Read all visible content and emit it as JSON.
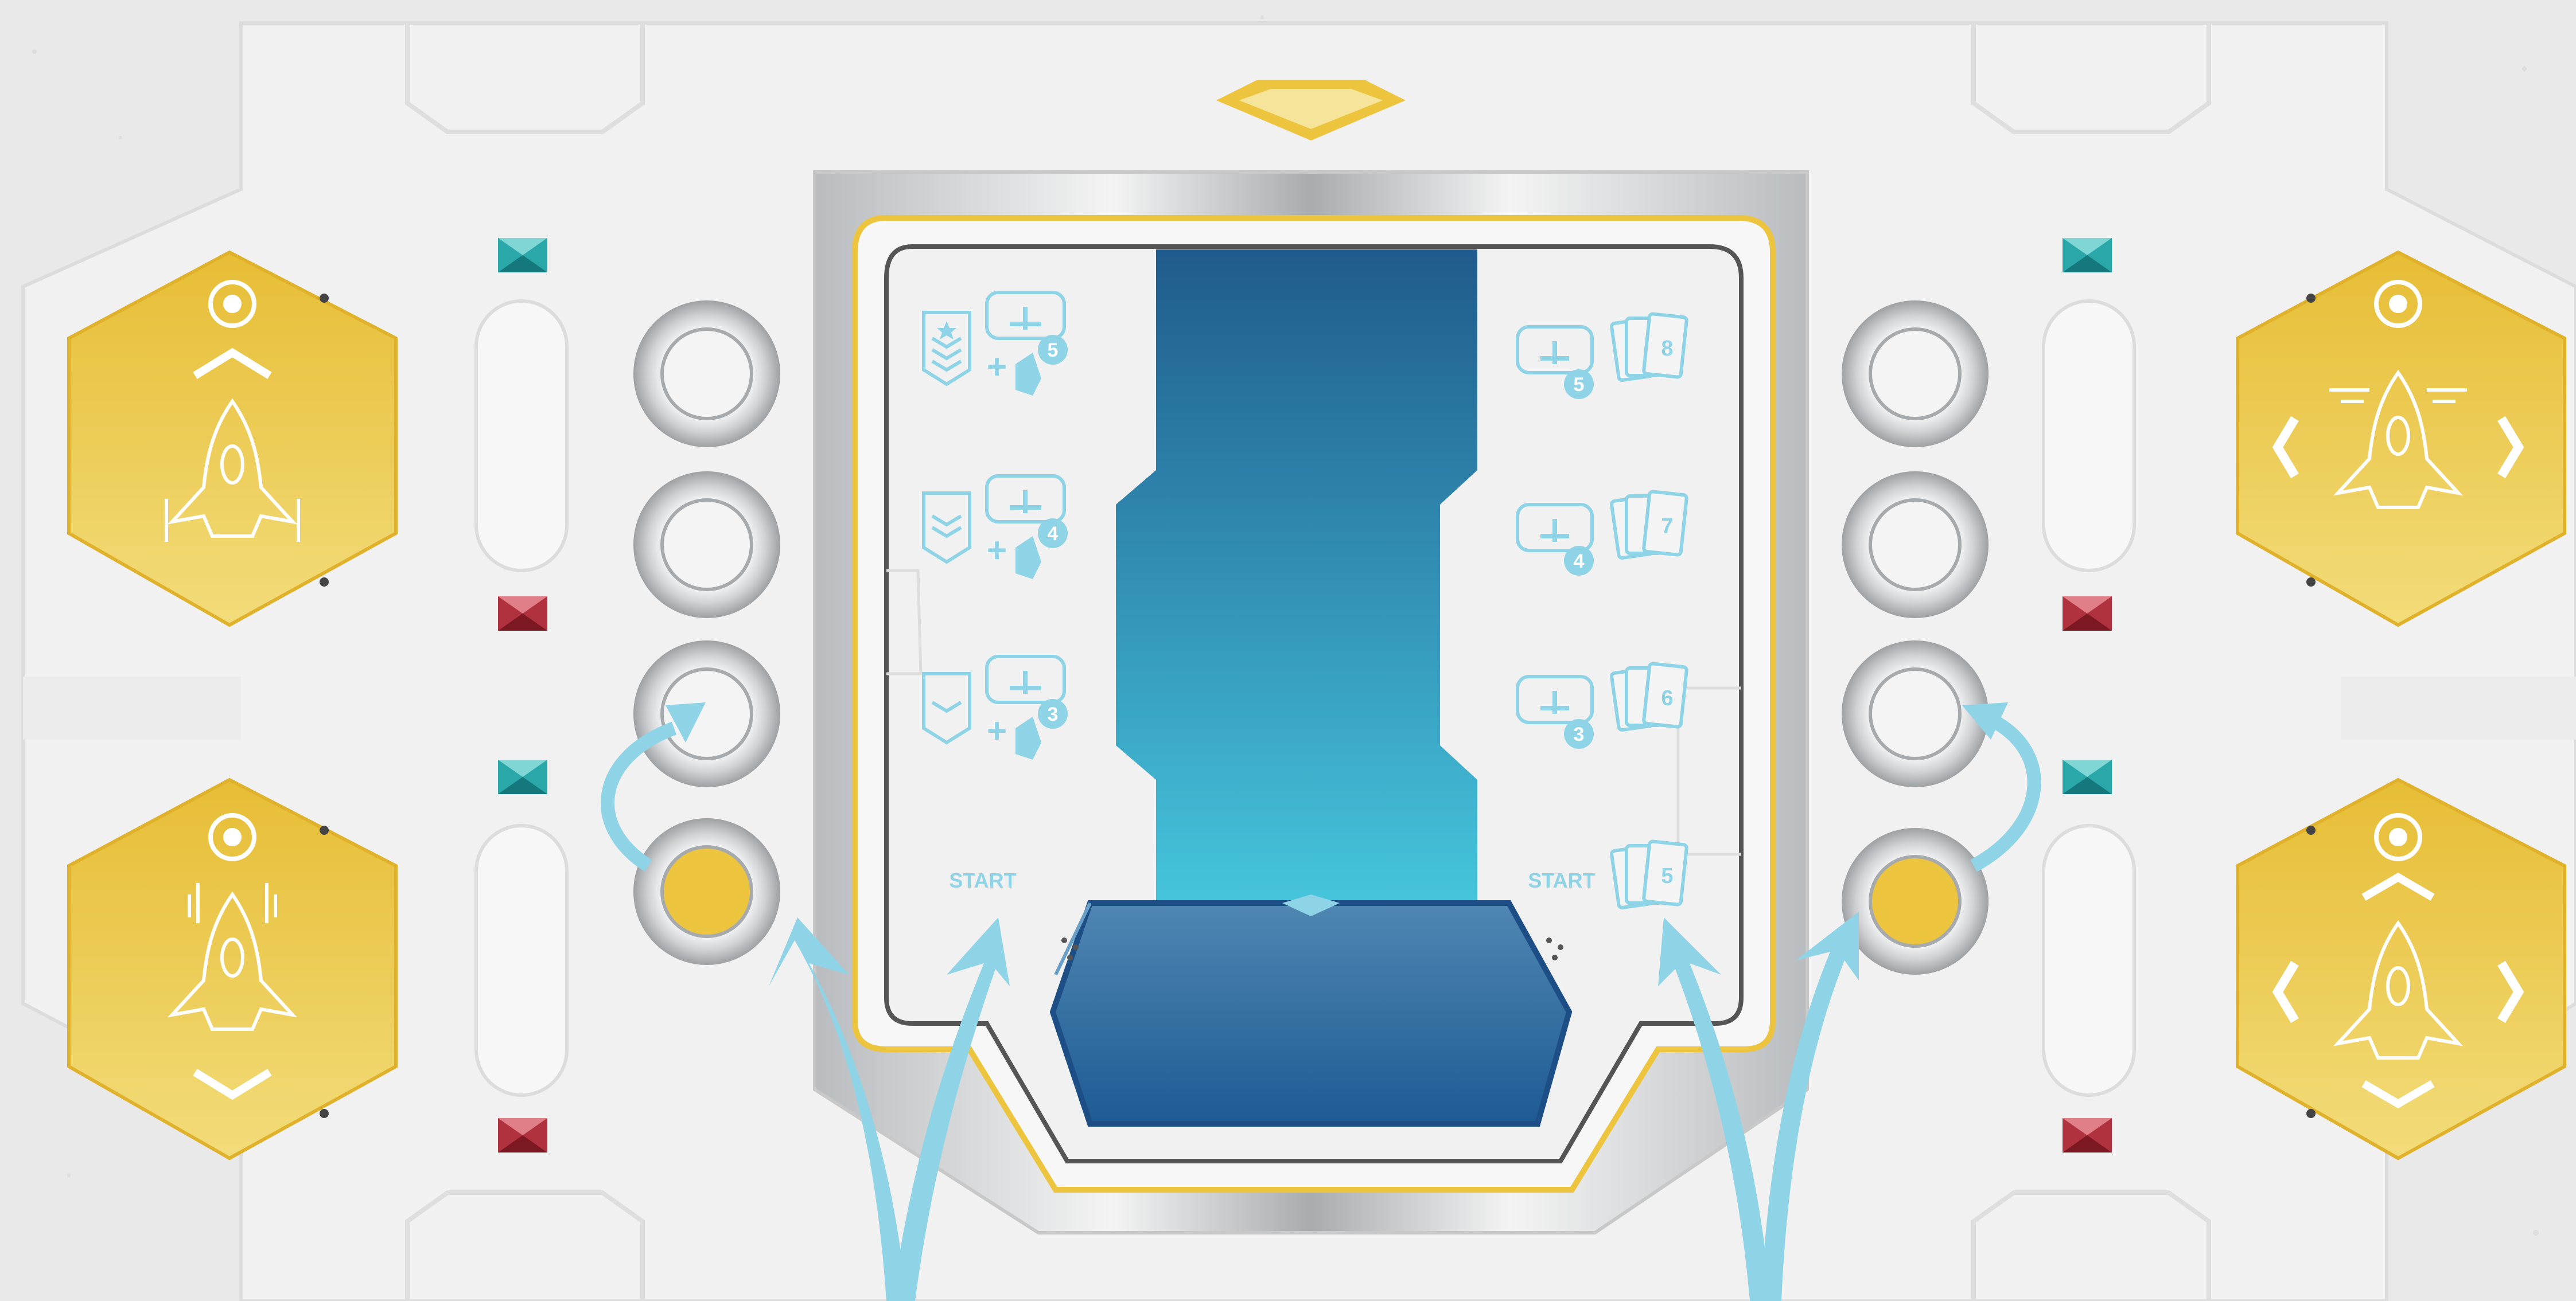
{
  "left_panel": {
    "ranks": [
      {
        "rank": "rank-3-chevrons-star",
        "fighters": "5"
      },
      {
        "rank": "rank-2-chevrons",
        "fighters": "4"
      },
      {
        "rank": "rank-1-chevron",
        "fighters": "3"
      }
    ],
    "start_label": "START"
  },
  "right_panel": {
    "rows": [
      {
        "fighters": "5",
        "cards": "8"
      },
      {
        "fighters": "4",
        "cards": "7"
      },
      {
        "fighters": "3",
        "cards": "6"
      },
      {
        "cards": "5"
      }
    ],
    "start_label": "START"
  },
  "icons": {
    "hex_top_left": [
      "target-icon",
      "chevron-up-icon",
      "ship-icon"
    ],
    "hex_bottom_left": [
      "target-icon",
      "ship-icon",
      "chevron-down-icon"
    ],
    "hex_top_right": [
      "target-icon",
      "chevron-left-icon",
      "ship-icon",
      "chevron-right-icon"
    ],
    "hex_bottom_right": [
      "target-icon",
      "chevron-up-icon",
      "ship-icon",
      "chevron-down-icon"
    ]
  },
  "colors": {
    "gold": "#ecc43e",
    "teal_gem": "#2aa7a9",
    "red_gem": "#b0323e",
    "cyan_accent": "#8fd3e6",
    "screen_top": "#1f5b8d",
    "screen_bottom": "#46c6dd"
  }
}
